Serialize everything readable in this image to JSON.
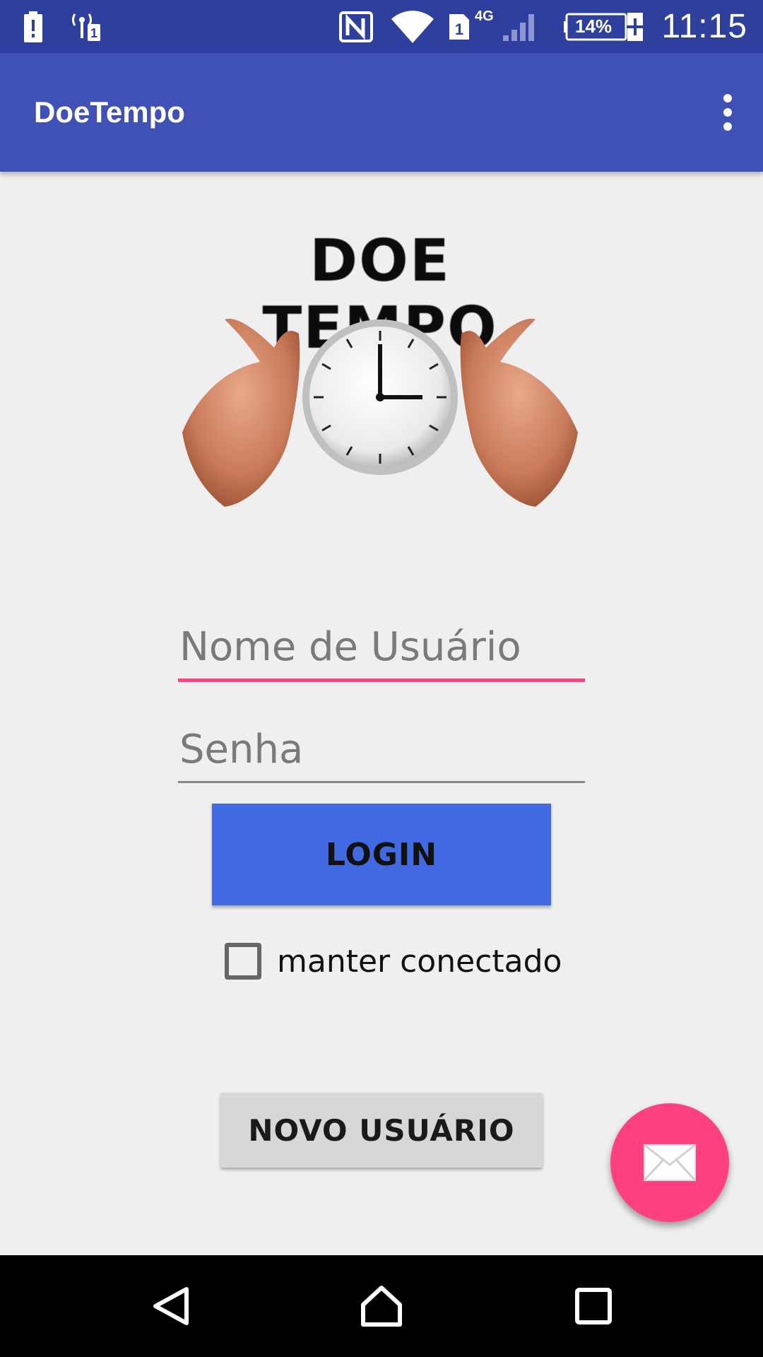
{
  "status_bar": {
    "time": "11:15",
    "battery_percent": "14%",
    "network_type": "4G",
    "sim_slot": "1",
    "icons": [
      "alert-icon",
      "hotspot-icon",
      "nfc-icon",
      "wifi-icon",
      "sim-icon",
      "signal-icon",
      "battery-charging-icon"
    ]
  },
  "app_bar": {
    "title": "DoeTempo",
    "overflow_icon": "more-vert-icon"
  },
  "logo": {
    "text": "DOE TEMPO",
    "image": "hands-holding-clock"
  },
  "form": {
    "username_placeholder": "Nome de Usuário",
    "password_placeholder": "Senha",
    "login_label": "LOGIN",
    "keep_connected_label": "manter conectado",
    "keep_connected_checked": false,
    "new_user_label": "NOVO USUÁRIO"
  },
  "fab": {
    "icon": "mail-icon"
  },
  "nav_bar": {
    "icons": [
      "back-icon",
      "home-icon",
      "recents-icon"
    ]
  },
  "colors": {
    "status_bar": "#2f3f9e",
    "primary": "#3f51b5",
    "accent": "#ff4081",
    "login_button": "#4169e1",
    "background": "#efefef"
  }
}
